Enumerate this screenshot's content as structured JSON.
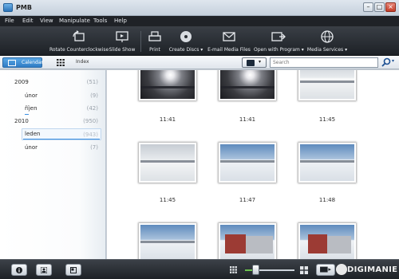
{
  "window": {
    "title": "PMB"
  },
  "menu": [
    "File",
    "Edit",
    "View",
    "Manipulate",
    "Tools",
    "Help"
  ],
  "toolbar": {
    "rotate": "Rotate Counterclockwise",
    "slideshow": "Slide Show",
    "print": "Print",
    "create_discs": "Create Discs",
    "email": "E-mail Media Files",
    "open_with": "Open with Program",
    "media_services": "Media Services"
  },
  "viewbar": {
    "calendar_tab": "Calendar",
    "index_tab": "Index",
    "search_placeholder": "Search"
  },
  "tree": [
    {
      "label": "2009",
      "count": "(51)",
      "level": 0
    },
    {
      "label": "únor",
      "count": "(9)",
      "level": 1
    },
    {
      "label": "říjen",
      "count": "(42)",
      "level": 1
    },
    {
      "label": "2010",
      "count": "(950)",
      "level": 0
    },
    {
      "label": "leden",
      "count": "(943)",
      "level": 1,
      "selected": true
    },
    {
      "label": "únor",
      "count": "(7)",
      "level": 1
    }
  ],
  "thumbnails": {
    "row1": [
      "11:41",
      "11:41",
      "11:45"
    ],
    "row2": [
      "11:45",
      "11:47",
      "11:48"
    ]
  },
  "footer": {
    "watermark": "DIGIMANIE"
  },
  "colors": {
    "accent": "#2f7cc4",
    "toolbar_bg": "#1d2126",
    "menubar_bg": "#1f2227"
  }
}
